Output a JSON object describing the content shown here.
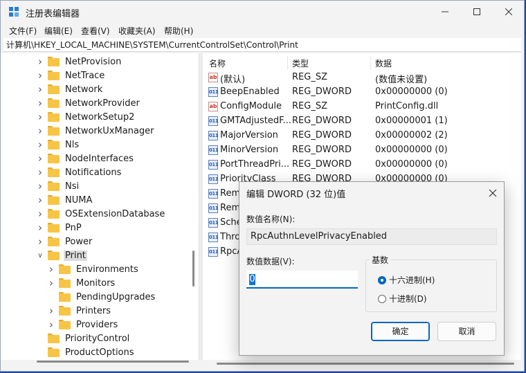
{
  "window": {
    "title": "注册表编辑器"
  },
  "menu": [
    "文件(F)",
    "编辑(E)",
    "查看(V)",
    "收藏夹(A)",
    "帮助(H)"
  ],
  "address": "计算机\\HKEY_LOCAL_MACHINE\\SYSTEM\\CurrentControlSet\\Control\\Print",
  "tree": [
    {
      "label": "NetProvision",
      "expandable": true
    },
    {
      "label": "NetTrace",
      "expandable": true
    },
    {
      "label": "Network",
      "expandable": true
    },
    {
      "label": "NetworkProvider",
      "expandable": true
    },
    {
      "label": "NetworkSetup2",
      "expandable": true
    },
    {
      "label": "NetworkUxManager",
      "expandable": true
    },
    {
      "label": "Nls",
      "expandable": true
    },
    {
      "label": "NodeInterfaces",
      "expandable": true
    },
    {
      "label": "Notifications",
      "expandable": true
    },
    {
      "label": "Nsi",
      "expandable": true
    },
    {
      "label": "NUMA",
      "expandable": true
    },
    {
      "label": "OSExtensionDatabase",
      "expandable": true
    },
    {
      "label": "PnP",
      "expandable": true
    },
    {
      "label": "Power",
      "expandable": true
    },
    {
      "label": "Print",
      "expandable": true,
      "expanded": true,
      "selected": true
    },
    {
      "label": "Environments",
      "expandable": true,
      "child": true
    },
    {
      "label": "Monitors",
      "expandable": true,
      "child": true
    },
    {
      "label": "PendingUpgrades",
      "expandable": false,
      "child": true
    },
    {
      "label": "Printers",
      "expandable": true,
      "child": true
    },
    {
      "label": "Providers",
      "expandable": true,
      "child": true
    },
    {
      "label": "PriorityControl",
      "expandable": false
    },
    {
      "label": "ProductOptions",
      "expandable": false
    }
  ],
  "columns": {
    "name": "名称",
    "type": "类型",
    "data": "数据"
  },
  "values": [
    {
      "icon": "ab",
      "name": "(默认)",
      "type": "REG_SZ",
      "data": "(数值未设置)"
    },
    {
      "icon": "dword",
      "name": "BeepEnabled",
      "type": "REG_DWORD",
      "data": "0x00000000 (0)"
    },
    {
      "icon": "ab",
      "name": "ConfigModule",
      "type": "REG_SZ",
      "data": "PrintConfig.dll"
    },
    {
      "icon": "dword",
      "name": "GMTAdjustedF...",
      "type": "REG_DWORD",
      "data": "0x00000001 (1)"
    },
    {
      "icon": "dword",
      "name": "MajorVersion",
      "type": "REG_DWORD",
      "data": "0x00000002 (2)"
    },
    {
      "icon": "dword",
      "name": "MinorVersion",
      "type": "REG_DWORD",
      "data": "0x00000000 (0)"
    },
    {
      "icon": "dword",
      "name": "PortThreadPri...",
      "type": "REG_DWORD",
      "data": "0x00000000 (0)"
    },
    {
      "icon": "dword",
      "name": "PriorityClass",
      "type": "REG_DWORD",
      "data": "0x00000000 (0)"
    },
    {
      "icon": "dword",
      "name": "Remo",
      "type": "",
      "data": ""
    },
    {
      "icon": "dword",
      "name": "Remo",
      "type": "",
      "data": ""
    },
    {
      "icon": "dword",
      "name": "Sche",
      "type": "",
      "data": ""
    },
    {
      "icon": "dword",
      "name": "Thro",
      "type": "",
      "data": ""
    },
    {
      "icon": "dword",
      "name": "RpcA",
      "type": "",
      "data": ""
    }
  ],
  "dialog": {
    "title": "编辑 DWORD (32 位)值",
    "name_label": "数值名称(N):",
    "name_value": "RpcAuthnLevelPrivacyEnabled",
    "data_label": "数值数据(V):",
    "data_value": "0",
    "base_label": "基数",
    "hex_label": "十六进制(H)",
    "dec_label": "十进制(D)",
    "selected_base": "hex",
    "ok_label": "确定",
    "cancel_label": "取消"
  }
}
